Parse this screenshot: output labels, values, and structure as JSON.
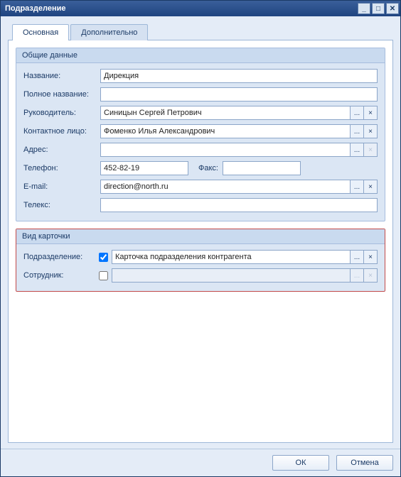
{
  "window": {
    "title": "Подразделение"
  },
  "tabs": {
    "main": "Основная",
    "additional": "Дополнительно"
  },
  "group_general": {
    "title": "Общие данные",
    "labels": {
      "name": "Название:",
      "fullname": "Полное название:",
      "manager": "Руководитель:",
      "contact": "Контактное лицо:",
      "address": "Адрес:",
      "phone": "Телефон:",
      "fax": "Факс:",
      "email": "E-mail:",
      "telex": "Телекс:"
    },
    "values": {
      "name": "Дирекция",
      "fullname": "",
      "manager": "Синицын Сергей Петрович",
      "contact": "Фоменко Илья Александрович",
      "address": "",
      "phone": "452-82-19",
      "fax": "",
      "email": "direction@north.ru",
      "telex": ""
    }
  },
  "group_cardview": {
    "title": "Вид карточки",
    "labels": {
      "department": "Подразделение:",
      "employee": "Сотрудник:"
    },
    "values": {
      "department_checked": true,
      "department_card": "Карточка подразделения контрагента",
      "employee_checked": false,
      "employee_card": ""
    }
  },
  "buttons": {
    "ok": "ОК",
    "cancel": "Отмена",
    "ellipsis": "...",
    "clear": "×"
  }
}
